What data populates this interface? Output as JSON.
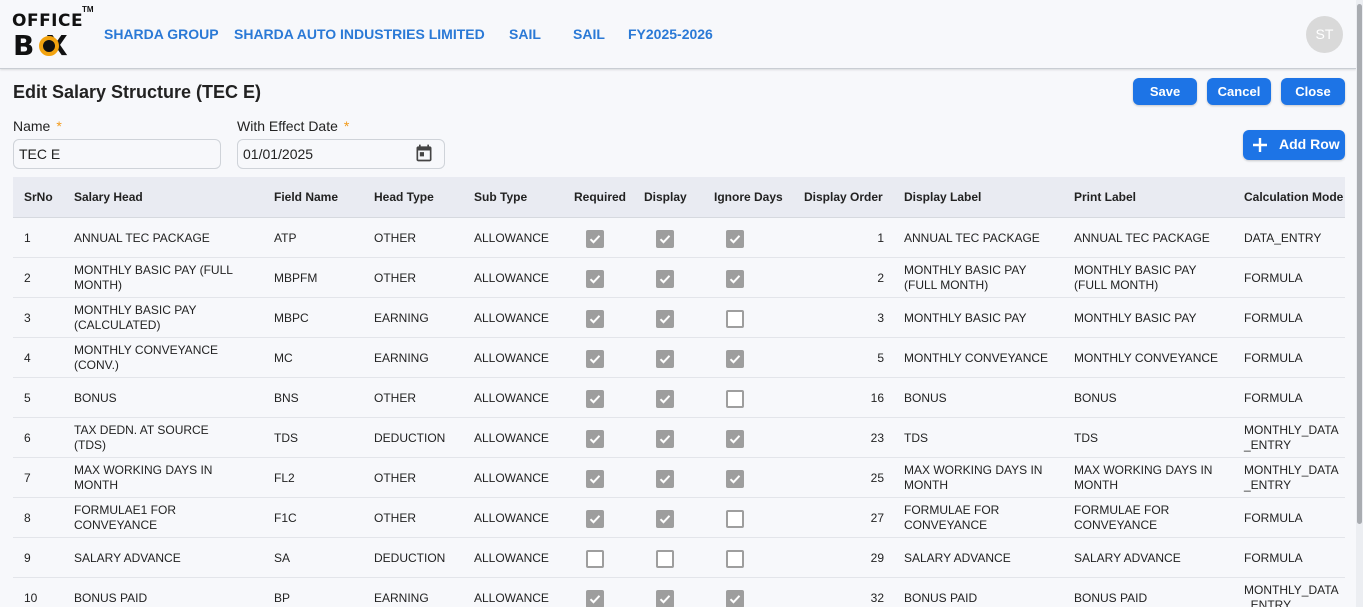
{
  "logo": {
    "line1": "OFFICE",
    "line2": "B X",
    "tm": "TM"
  },
  "nav": {
    "group": "SHARDA GROUP",
    "company": "SHARDA AUTO INDUSTRIES LIMITED",
    "unit1": "SAIL",
    "unit2": "SAIL",
    "fy": "FY2025-2026"
  },
  "user": {
    "initials": "ST"
  },
  "page": {
    "title": "Edit Salary Structure (TEC E)"
  },
  "buttons": {
    "save": "Save",
    "cancel": "Cancel",
    "close": "Close",
    "add_row": "Add Row"
  },
  "form": {
    "name_label": "Name",
    "name_value": "TEC E",
    "date_label": "With Effect Date",
    "date_value": "01/01/2025",
    "required_mark": "*"
  },
  "table": {
    "headers": [
      "SrNo",
      "Salary Head",
      "Field Name",
      "Head Type",
      "Sub Type",
      "Required",
      "Display",
      "Ignore Days",
      "Display Order",
      "Display Label",
      "Print Label",
      "Calculation Mode"
    ],
    "rows": [
      {
        "sr": "1",
        "head": "ANNUAL TEC PACKAGE",
        "field": "ATP",
        "type": "OTHER",
        "sub": "ALLOWANCE",
        "req": true,
        "disp": true,
        "ign": true,
        "order": "1",
        "dlabel": "ANNUAL TEC PACKAGE",
        "plabel": "ANNUAL TEC PACKAGE",
        "mode": "DATA_ENTRY"
      },
      {
        "sr": "2",
        "head": "MONTHLY BASIC PAY (FULL MONTH)",
        "field": "MBPFM",
        "type": "OTHER",
        "sub": "ALLOWANCE",
        "req": true,
        "disp": true,
        "ign": true,
        "order": "2",
        "dlabel": "MONTHLY BASIC PAY (FULL MONTH)",
        "plabel": "MONTHLY BASIC PAY (FULL MONTH)",
        "mode": "FORMULA"
      },
      {
        "sr": "3",
        "head": "MONTHLY BASIC PAY (CALCULATED)",
        "field": "MBPC",
        "type": "EARNING",
        "sub": "ALLOWANCE",
        "req": true,
        "disp": true,
        "ign": false,
        "order": "3",
        "dlabel": "MONTHLY BASIC PAY",
        "plabel": "MONTHLY BASIC PAY",
        "mode": "FORMULA"
      },
      {
        "sr": "4",
        "head": "MONTHLY CONVEYANCE (CONV.)",
        "field": "MC",
        "type": "EARNING",
        "sub": "ALLOWANCE",
        "req": true,
        "disp": true,
        "ign": true,
        "order": "5",
        "dlabel": "MONTHLY CONVEYANCE",
        "plabel": "MONTHLY CONVEYANCE",
        "mode": "FORMULA"
      },
      {
        "sr": "5",
        "head": "BONUS",
        "field": "BNS",
        "type": "OTHER",
        "sub": "ALLOWANCE",
        "req": true,
        "disp": true,
        "ign": false,
        "order": "16",
        "dlabel": "BONUS",
        "plabel": "BONUS",
        "mode": "FORMULA"
      },
      {
        "sr": "6",
        "head": "TAX DEDN. AT SOURCE (TDS)",
        "field": "TDS",
        "type": "DEDUCTION",
        "sub": "ALLOWANCE",
        "req": true,
        "disp": true,
        "ign": true,
        "order": "23",
        "dlabel": "TDS",
        "plabel": "TDS",
        "mode": "MONTHLY_DATA_ENTRY"
      },
      {
        "sr": "7",
        "head": "MAX WORKING DAYS IN MONTH",
        "field": "FL2",
        "type": "OTHER",
        "sub": "ALLOWANCE",
        "req": true,
        "disp": true,
        "ign": true,
        "order": "25",
        "dlabel": "MAX WORKING DAYS IN MONTH",
        "plabel": "MAX WORKING DAYS IN MONTH",
        "mode": "MONTHLY_DATA_ENTRY"
      },
      {
        "sr": "8",
        "head": "FORMULAE1 FOR CONVEYANCE",
        "field": "F1C",
        "type": "OTHER",
        "sub": "ALLOWANCE",
        "req": true,
        "disp": true,
        "ign": false,
        "order": "27",
        "dlabel": "FORMULAE FOR CONVEYANCE",
        "plabel": "FORMULAE FOR CONVEYANCE",
        "mode": "FORMULA"
      },
      {
        "sr": "9",
        "head": "SALARY ADVANCE",
        "field": "SA",
        "type": "DEDUCTION",
        "sub": "ALLOWANCE",
        "req": false,
        "disp": false,
        "ign": false,
        "order": "29",
        "dlabel": "SALARY ADVANCE",
        "plabel": "SALARY ADVANCE",
        "mode": "FORMULA"
      },
      {
        "sr": "10",
        "head": "BONUS PAID",
        "field": "BP",
        "type": "EARNING",
        "sub": "ALLOWANCE",
        "req": true,
        "disp": true,
        "ign": true,
        "order": "32",
        "dlabel": "BONUS PAID",
        "plabel": "BONUS PAID",
        "mode": "MONTHLY_DATA_ENTRY"
      }
    ]
  },
  "icons": {
    "calendar": "calendar-icon",
    "plus": "plus-icon",
    "check": "check-icon"
  },
  "colors": {
    "accent": "#1d74e6",
    "nav_link": "#2a79d6",
    "required": "#f29a1a",
    "checkbox": "#9e9e9e"
  }
}
